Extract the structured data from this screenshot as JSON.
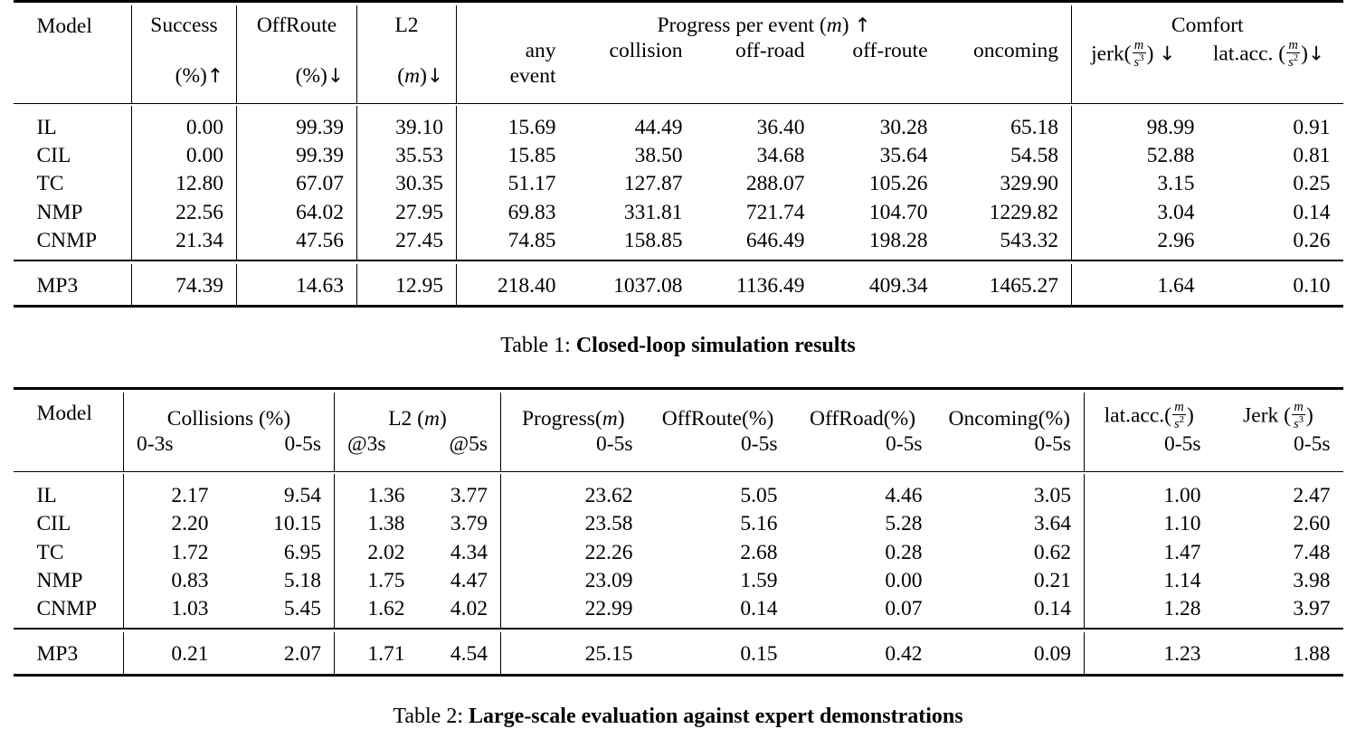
{
  "table1": {
    "caption_label": "Table 1:",
    "caption_text": "Closed-loop simulation results",
    "headers": {
      "model": "Model",
      "success": "Success",
      "success_unit": "(%)",
      "offroute": "OffRoute",
      "offroute_unit": "(%)",
      "l2": "L2",
      "l2_unit_open": "(",
      "l2_unit_m": "m",
      "l2_unit_close": ")",
      "progress_group": "Progress per event",
      "progress_group_unit_m": "m",
      "comfort_group": "Comfort",
      "sub_any": "any",
      "sub_event": "event",
      "sub_collision": "collision",
      "sub_offroad": "off-road",
      "sub_offroute": "off-route",
      "sub_oncoming": "oncoming",
      "jerk_label": "jerk(",
      "jerk_close": ")",
      "jerk_num": "m",
      "jerk_den": "s",
      "jerk_exp": "3",
      "latacc_label": "lat.acc. (",
      "latacc_close": ")",
      "latacc_num": "m",
      "latacc_den": "s",
      "latacc_exp": "2",
      "arrow_up": "↑",
      "arrow_down": "↓"
    },
    "rows": [
      {
        "model": "IL",
        "success": "0.00",
        "offroute": "99.39",
        "l2": "39.10",
        "any": "15.69",
        "collision": "44.49",
        "offroad": "36.40",
        "offroute_p": "30.28",
        "oncoming": "65.18",
        "jerk": "98.99",
        "latacc": "0.91"
      },
      {
        "model": "CIL",
        "success": "0.00",
        "offroute": "99.39",
        "l2": "35.53",
        "any": "15.85",
        "collision": "38.50",
        "offroad": "34.68",
        "offroute_p": "35.64",
        "oncoming": "54.58",
        "jerk": "52.88",
        "latacc": "0.81"
      },
      {
        "model": "TC",
        "success": "12.80",
        "offroute": "67.07",
        "l2": "30.35",
        "any": "51.17",
        "collision": "127.87",
        "offroad": "288.07",
        "offroute_p": "105.26",
        "oncoming": "329.90",
        "jerk": "3.15",
        "latacc": "0.25"
      },
      {
        "model": "NMP",
        "success": "22.56",
        "offroute": "64.02",
        "l2": "27.95",
        "any": "69.83",
        "collision": "331.81",
        "offroad": "721.74",
        "offroute_p": "104.70",
        "oncoming": "1229.82",
        "jerk": "3.04",
        "latacc": "0.14"
      },
      {
        "model": "CNMP",
        "success": "21.34",
        "offroute": "47.56",
        "l2": "27.45",
        "any": "74.85",
        "collision": "158.85",
        "offroad": "646.49",
        "offroute_p": "198.28",
        "oncoming": "543.32",
        "jerk": "2.96",
        "latacc": "0.26"
      }
    ],
    "highlight_row": {
      "model": "MP3",
      "success": "74.39",
      "offroute": "14.63",
      "l2": "12.95",
      "any": "218.40",
      "collision": "1037.08",
      "offroad": "1136.49",
      "offroute_p": "409.34",
      "oncoming": "1465.27",
      "jerk": "1.64",
      "latacc": "0.10"
    }
  },
  "table2": {
    "caption_label": "Table 2:",
    "caption_text": "Large-scale evaluation against expert demonstrations",
    "headers": {
      "model": "Model",
      "collisions": "Collisions",
      "collisions_unit": "(%)",
      "l2": "L2",
      "l2_unit_m": "m",
      "progress": "Progress(",
      "progress_m": "m",
      "progress_close": ")",
      "offroute": "OffRoute(%)",
      "offroad": "OffRoad(%)",
      "oncoming": "Oncoming(%)",
      "latacc_label": "lat.acc.(",
      "latacc_close": ")",
      "latacc_num": "m",
      "latacc_den": "s",
      "latacc_exp": "2",
      "jerk_label": "Jerk (",
      "jerk_close": ")",
      "jerk_num": "m",
      "jerk_den": "s",
      "jerk_exp": "3",
      "sub_0_3s": "0-3s",
      "sub_0_5s": "0-5s",
      "sub_at3s": "@3s",
      "sub_at5s": "@5s"
    },
    "rows": [
      {
        "model": "IL",
        "col03": "2.17",
        "col05": "9.54",
        "l2_3": "1.36",
        "l2_5": "3.77",
        "progress": "23.62",
        "offroute": "5.05",
        "offroad": "4.46",
        "oncoming": "3.05",
        "latacc": "1.00",
        "jerk": "2.47",
        "bold": [
          "l2_3",
          "l2_5",
          "latacc"
        ]
      },
      {
        "model": "CIL",
        "col03": "2.20",
        "col05": "10.15",
        "l2_3": "1.38",
        "l2_5": "3.79",
        "progress": "23.58",
        "offroute": "5.16",
        "offroad": "5.28",
        "oncoming": "3.64",
        "latacc": "1.10",
        "jerk": "2.60",
        "bold": []
      },
      {
        "model": "TC",
        "col03": "1.72",
        "col05": "6.95",
        "l2_3": "2.02",
        "l2_5": "4.34",
        "progress": "22.26",
        "offroute": "2.68",
        "offroad": "0.28",
        "oncoming": "0.62",
        "latacc": "1.47",
        "jerk": "7.48",
        "bold": []
      },
      {
        "model": "NMP",
        "col03": "0.83",
        "col05": "5.18",
        "l2_3": "1.75",
        "l2_5": "4.47",
        "progress": "23.09",
        "offroute": "1.59",
        "offroad": "0.00",
        "oncoming": "0.21",
        "latacc": "1.14",
        "jerk": "3.98",
        "bold": [
          "offroad"
        ]
      },
      {
        "model": "CNMP",
        "col03": "1.03",
        "col05": "5.45",
        "l2_3": "1.62",
        "l2_5": "4.02",
        "progress": "22.99",
        "offroute": "0.14",
        "offroad": "0.07",
        "oncoming": "0.14",
        "latacc": "1.28",
        "jerk": "3.97",
        "bold": [
          "offroute"
        ]
      }
    ],
    "highlight_row": {
      "model": "MP3",
      "col03": "0.21",
      "col05": "2.07",
      "l2_3": "1.71",
      "l2_5": "4.54",
      "progress": "25.15",
      "offroute": "0.15",
      "offroad": "0.42",
      "oncoming": "0.09",
      "latacc": "1.23",
      "jerk": "1.88",
      "bold": [
        "col03",
        "col05",
        "progress",
        "oncoming",
        "jerk"
      ]
    }
  }
}
